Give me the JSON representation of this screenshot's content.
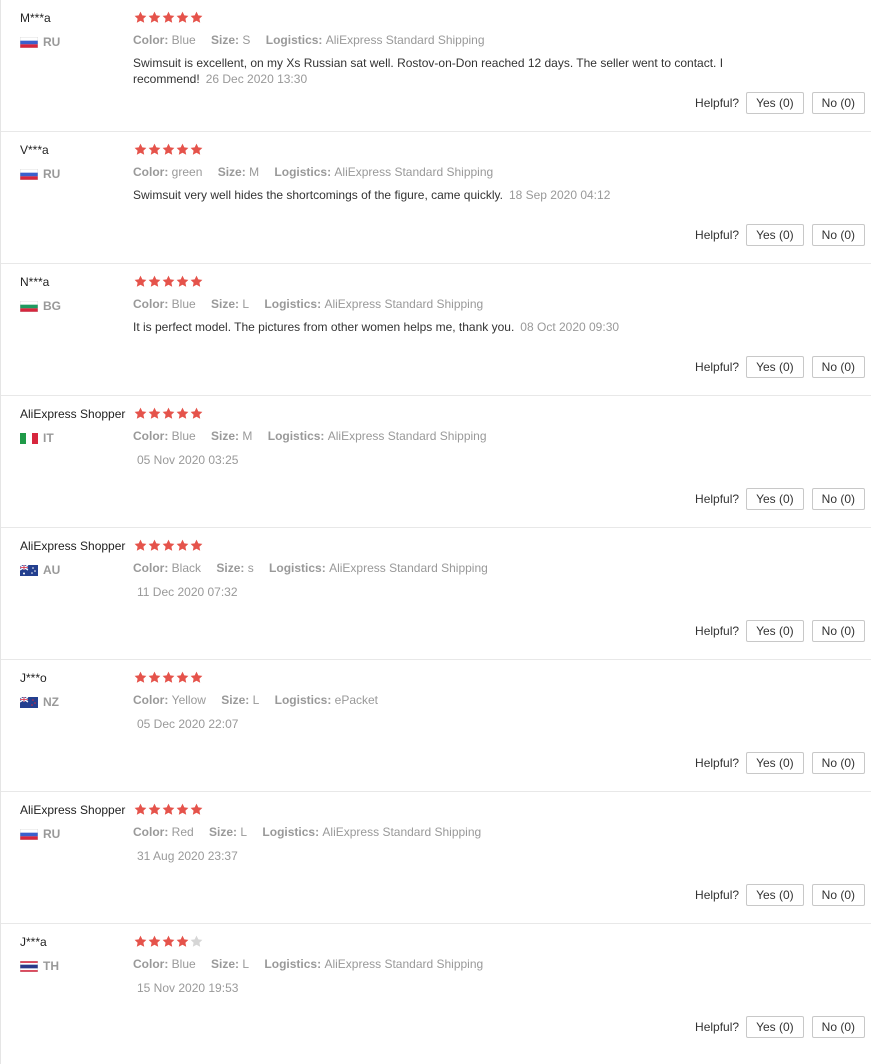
{
  "colors": {
    "star_on": "#e5534b",
    "star_off": "#d6d6d6"
  },
  "labels": {
    "color": "Color:",
    "size": "Size:",
    "logistics": "Logistics:",
    "helpful": "Helpful?"
  },
  "reviews": [
    {
      "user": "M***a",
      "country": "RU",
      "flag": "ru",
      "rating": 5,
      "color": "Blue",
      "size": "S",
      "logistics": "AliExpress Standard Shipping",
      "content": "Swimsuit is excellent, on my Xs Russian sat well. Rostov-on-Don reached 12 days. The seller went to contact. I recommend!",
      "date": "26 Dec 2020 13:30",
      "yes": "Yes (0)",
      "no": "No (0)"
    },
    {
      "user": "V***a",
      "country": "RU",
      "flag": "ru",
      "rating": 5,
      "color": "green",
      "size": "M",
      "logistics": "AliExpress Standard Shipping",
      "content": "Swimsuit very well hides the shortcomings of the figure, came quickly.",
      "date": "18 Sep 2020 04:12",
      "yes": "Yes (0)",
      "no": "No (0)"
    },
    {
      "user": "N***a",
      "country": "BG",
      "flag": "bg",
      "rating": 5,
      "color": "Blue",
      "size": "L",
      "logistics": "AliExpress Standard Shipping",
      "content": "It is perfect model. The pictures from other women helps me, thank you.",
      "date": "08 Oct 2020 09:30",
      "yes": "Yes (0)",
      "no": "No (0)"
    },
    {
      "user": "AliExpress Shopper",
      "country": "IT",
      "flag": "it",
      "rating": 5,
      "color": "Blue",
      "size": "M",
      "logistics": "AliExpress Standard Shipping",
      "content": "",
      "date": "05 Nov 2020 03:25",
      "yes": "Yes (0)",
      "no": "No (0)"
    },
    {
      "user": "AliExpress Shopper",
      "country": "AU",
      "flag": "au",
      "rating": 5,
      "color": "Black",
      "size": "s",
      "logistics": "AliExpress Standard Shipping",
      "content": "",
      "date": "11 Dec 2020 07:32",
      "yes": "Yes (0)",
      "no": "No (0)"
    },
    {
      "user": "J***o",
      "country": "NZ",
      "flag": "nz",
      "rating": 5,
      "color": "Yellow",
      "size": "L",
      "logistics": "ePacket",
      "content": "",
      "date": "05 Dec 2020 22:07",
      "yes": "Yes (0)",
      "no": "No (0)"
    },
    {
      "user": "AliExpress Shopper",
      "country": "RU",
      "flag": "ru",
      "rating": 5,
      "color": "Red",
      "size": "L",
      "logistics": "AliExpress Standard Shipping",
      "content": "",
      "date": "31 Aug 2020 23:37",
      "yes": "Yes (0)",
      "no": "No (0)"
    },
    {
      "user": "J***a",
      "country": "TH",
      "flag": "th",
      "rating": 4,
      "color": "Blue",
      "size": "L",
      "logistics": "AliExpress Standard Shipping",
      "content": "",
      "date": "15 Nov 2020 19:53",
      "yes": "Yes (0)",
      "no": "No (0)"
    }
  ]
}
